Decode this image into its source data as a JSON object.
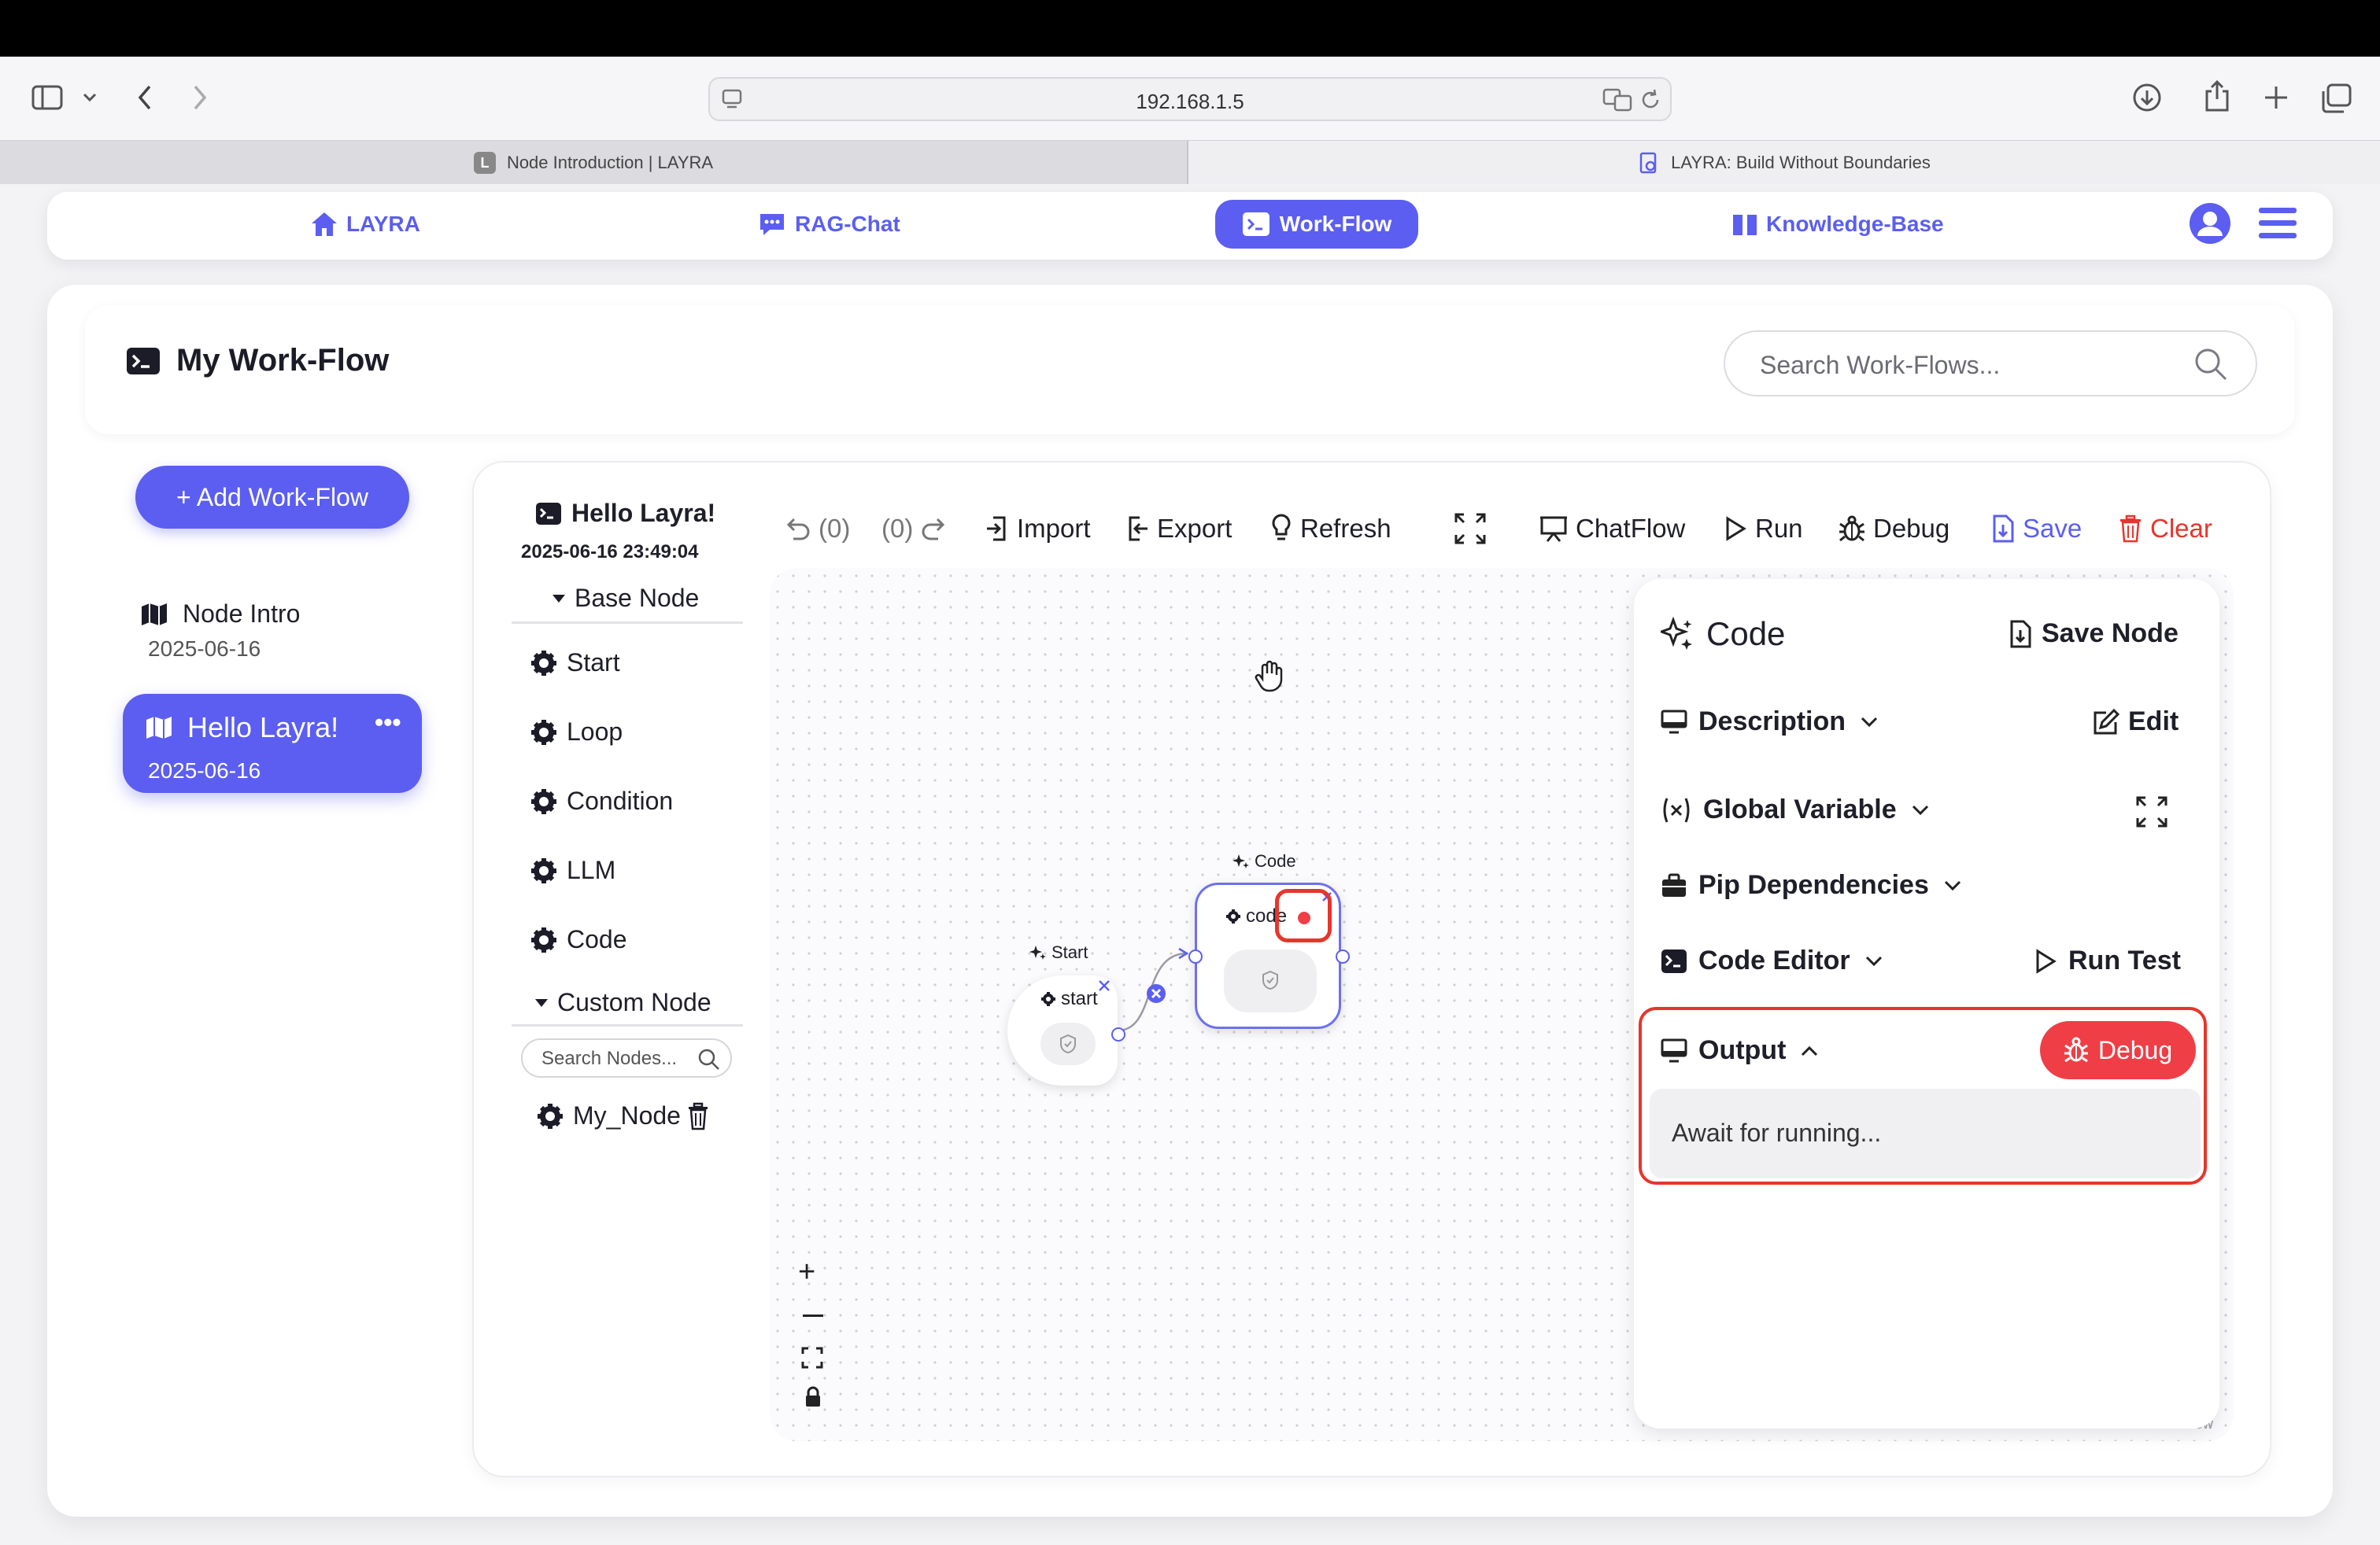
{
  "browser": {
    "url": "192.168.1.5",
    "tabs": [
      {
        "label": "Node Introduction | LAYRA",
        "favicon": "L"
      },
      {
        "label": "LAYRA: Build Without Boundaries"
      }
    ]
  },
  "nav": {
    "home": "LAYRA",
    "chat": "RAG-Chat",
    "workflow": "Work-Flow",
    "kb": "Knowledge-Base"
  },
  "header": {
    "title": "My Work-Flow",
    "search_placeholder": "Search Work-Flows..."
  },
  "sidebar": {
    "add_button": "+ Add Work-Flow",
    "workflows": [
      {
        "name": "Node Intro",
        "date": "2025-06-16"
      },
      {
        "name": "Hello Layra!",
        "date": "2025-06-16",
        "more": "•••"
      }
    ]
  },
  "editor": {
    "workflow_title": "Hello Layra!",
    "timestamp": "2025-06-16 23:49:04",
    "base_section": "Base Node",
    "base_nodes": [
      "Start",
      "Loop",
      "Condition",
      "LLM",
      "Code"
    ],
    "custom_section": "Custom Node",
    "node_search_placeholder": "Search Nodes...",
    "custom_nodes": [
      "My_Node"
    ]
  },
  "toolbar": {
    "undo": "(0)",
    "redo": "(0)",
    "import": "Import",
    "export": "Export",
    "refresh": "Refresh",
    "chatflow": "ChatFlow",
    "run": "Run",
    "debug": "Debug",
    "save": "Save",
    "clear": "Clear"
  },
  "canvas": {
    "start_node": {
      "type_label": "Start",
      "name": "start"
    },
    "code_node": {
      "type_label": "Code",
      "name": "code"
    },
    "attribution": "React Flow"
  },
  "props": {
    "title": "Code",
    "save_node": "Save Node",
    "description": "Description",
    "edit": "Edit",
    "global_variable": "Global Variable",
    "pip": "Pip Dependencies",
    "code_editor": "Code Editor",
    "run_test": "Run Test",
    "output": "Output",
    "debug": "Debug",
    "output_text": "Await for running..."
  },
  "colors": {
    "accent": "#5b5ef0",
    "danger": "#ef3e46",
    "highlight": "#e8352c"
  }
}
